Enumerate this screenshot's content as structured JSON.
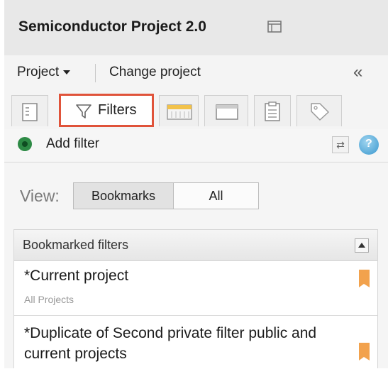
{
  "header": {
    "title": "Semiconductor Project 2.0"
  },
  "project_bar": {
    "project_label": "Project",
    "change_label": "Change project",
    "collapse_glyph": "«"
  },
  "tabs": [
    {
      "id": "details",
      "icon": "document-list-icon"
    },
    {
      "id": "filters",
      "label": "Filters",
      "icon": "funnel-icon",
      "selected": true
    },
    {
      "id": "timeline",
      "icon": "timeline-icon"
    },
    {
      "id": "window",
      "icon": "window-icon"
    },
    {
      "id": "clipboard",
      "icon": "clipboard-icon"
    },
    {
      "id": "tags",
      "icon": "tag-icon"
    }
  ],
  "filter_bar": {
    "add_label": "Add filter",
    "help_glyph": "?",
    "sync_glyph": "⇄"
  },
  "view": {
    "label": "View:",
    "options": [
      "Bookmarks",
      "All"
    ],
    "selected": "Bookmarks"
  },
  "list": {
    "header": "Bookmarked filters",
    "items": [
      {
        "name": "*Current project",
        "subtitle": "All Projects"
      },
      {
        "name": "*Duplicate of Second private filter public and current projects"
      }
    ]
  },
  "colors": {
    "accent": "#e0533a",
    "bookmark": "#f2a24d",
    "add": "#2d8a45",
    "help": "#3a98cf"
  }
}
